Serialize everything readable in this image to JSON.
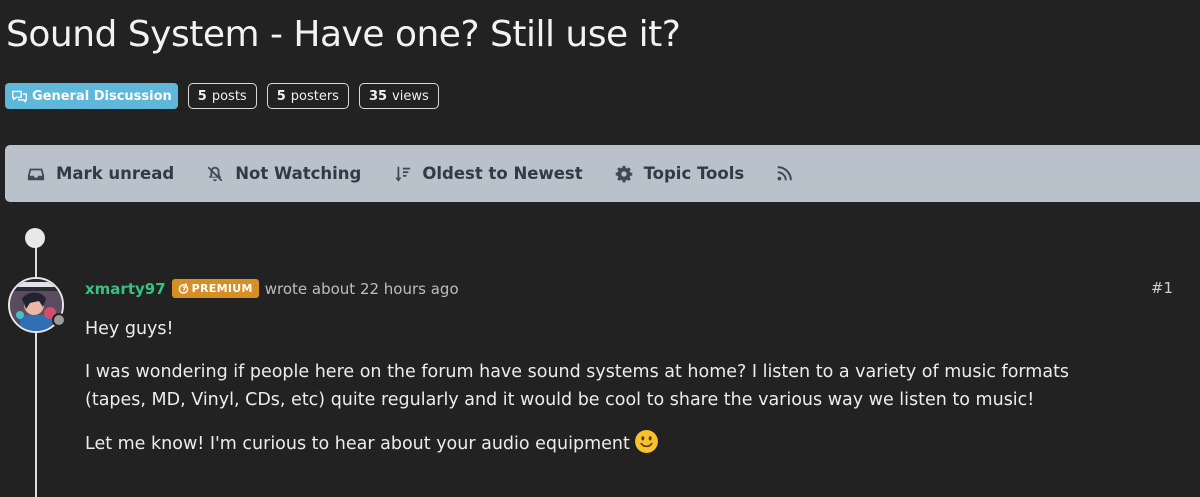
{
  "topic": {
    "title": "Sound System - Have one? Still use it?",
    "category": "General Discussion",
    "stats": [
      {
        "count": "5",
        "label": "posts"
      },
      {
        "count": "5",
        "label": "posters"
      },
      {
        "count": "35",
        "label": "views"
      }
    ]
  },
  "toolbar": {
    "items": [
      {
        "label": "Mark unread",
        "icon": "inbox-icon"
      },
      {
        "label": "Not Watching",
        "icon": "bell-slash-icon"
      },
      {
        "label": "Oldest to Newest",
        "icon": "sort-icon"
      },
      {
        "label": "Topic Tools",
        "icon": "gear-icon"
      },
      {
        "label": "",
        "icon": "rss-icon"
      }
    ]
  },
  "post": {
    "author": "xmarty97",
    "badge": "PREMIUM",
    "meta": "wrote about 22 hours ago",
    "number": "#1",
    "paragraphs": [
      "Hey guys!",
      "I was wondering if people here on the forum have sound systems at home? I listen to a variety of music formats (tapes, MD, Vinyl, CDs, etc) quite regularly and it would be cool to share the various way we listen to music!",
      "Let me know! I'm curious to hear about your audio equipment"
    ]
  },
  "colors": {
    "background": "#222222",
    "category_badge": "#5fb7d9",
    "toolbar": "#b9c2cb",
    "username": "#36c27d",
    "premium_badge": "#d68f25"
  }
}
